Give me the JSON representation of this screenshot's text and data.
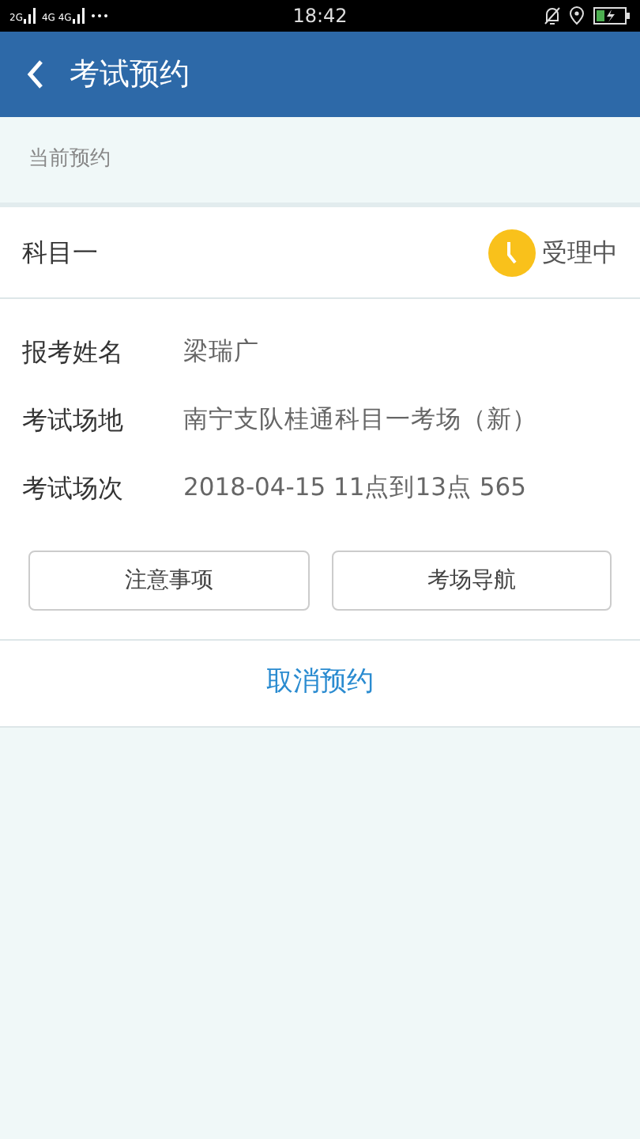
{
  "status_bar": {
    "network_labels": [
      "2G",
      "4G 4G"
    ],
    "time": "18:42"
  },
  "header": {
    "title": "考试预约"
  },
  "section_label": "当前预约",
  "booking": {
    "subject": "科目一",
    "status": "受理中",
    "fields": [
      {
        "label": "报考姓名",
        "value": "梁瑞广"
      },
      {
        "label": "考试场地",
        "value": "南宁支队桂通科目一考场（新）"
      },
      {
        "label": "考试场次",
        "value": "2018-04-15 11点到13点 565"
      }
    ],
    "buttons": [
      "注意事项",
      "考场导航"
    ],
    "cancel": "取消预约"
  }
}
